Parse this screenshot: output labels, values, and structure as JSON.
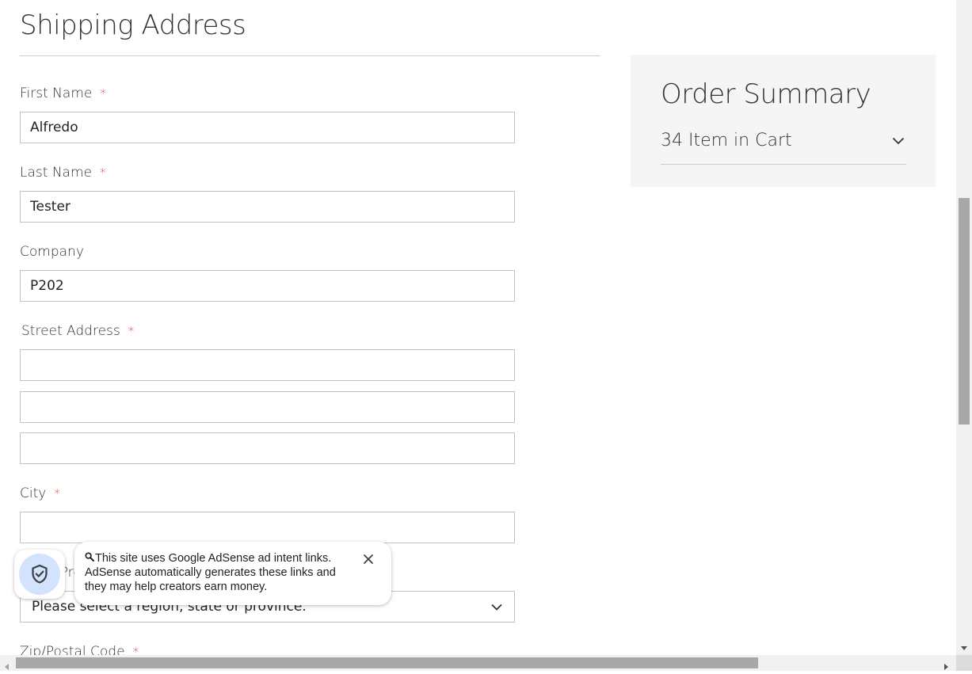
{
  "shipping": {
    "title": "Shipping Address",
    "required_mark": "*",
    "first_name": {
      "label": "First Name",
      "value": "Alfredo"
    },
    "last_name": {
      "label": "Last Name",
      "value": "Tester"
    },
    "company": {
      "label": "Company",
      "value": "P202"
    },
    "street": {
      "label": "Street Address",
      "line1": "",
      "line2": "",
      "line3": ""
    },
    "city": {
      "label": "City",
      "value": ""
    },
    "region": {
      "label": "State/Province",
      "selected": "Please select a region, state or province."
    },
    "zip": {
      "label": "Zip/Postal Code"
    }
  },
  "summary": {
    "title": "Order Summary",
    "items_in_cart": "34 Item in Cart"
  },
  "ad_notice": {
    "text": "This site uses Google AdSense ad intent links. AdSense automatically generates these links and they may help creators earn money.",
    "icons": {
      "badge": "shield-check-icon",
      "search": "search-icon",
      "close": "close-icon"
    }
  },
  "colors": {
    "required": "#e02b27",
    "panel_bg": "#f5f5f5",
    "shield_bg": "#d3e3fd"
  }
}
